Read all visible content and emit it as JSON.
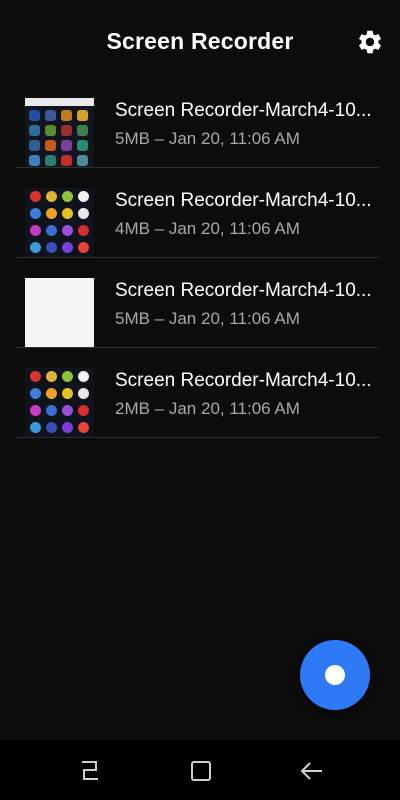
{
  "app": {
    "title": "Screen Recorder"
  },
  "icons": {
    "settings": "gear-icon",
    "record": "record-icon",
    "recent_apps": "recent-apps-icon",
    "home": "home-icon",
    "back": "back-icon"
  },
  "colors": {
    "background": "#0c0c0c",
    "fab": "#2e79f6",
    "divider": "#2e2e2e",
    "secondary_text": "#a8a8a8"
  },
  "recordings": [
    {
      "name": "Screen Recorder-March4-10...",
      "meta": "5MB – Jan 20, 11:06 AM"
    },
    {
      "name": "Screen Recorder-March4-10...",
      "meta": "4MB – Jan 20, 11:06 AM"
    },
    {
      "name": "Screen Recorder-March4-10...",
      "meta": "5MB – Jan 20, 11:06 AM"
    },
    {
      "name": "Screen Recorder-March4-10...",
      "meta": "2MB – Jan 20, 11:06 AM"
    }
  ]
}
